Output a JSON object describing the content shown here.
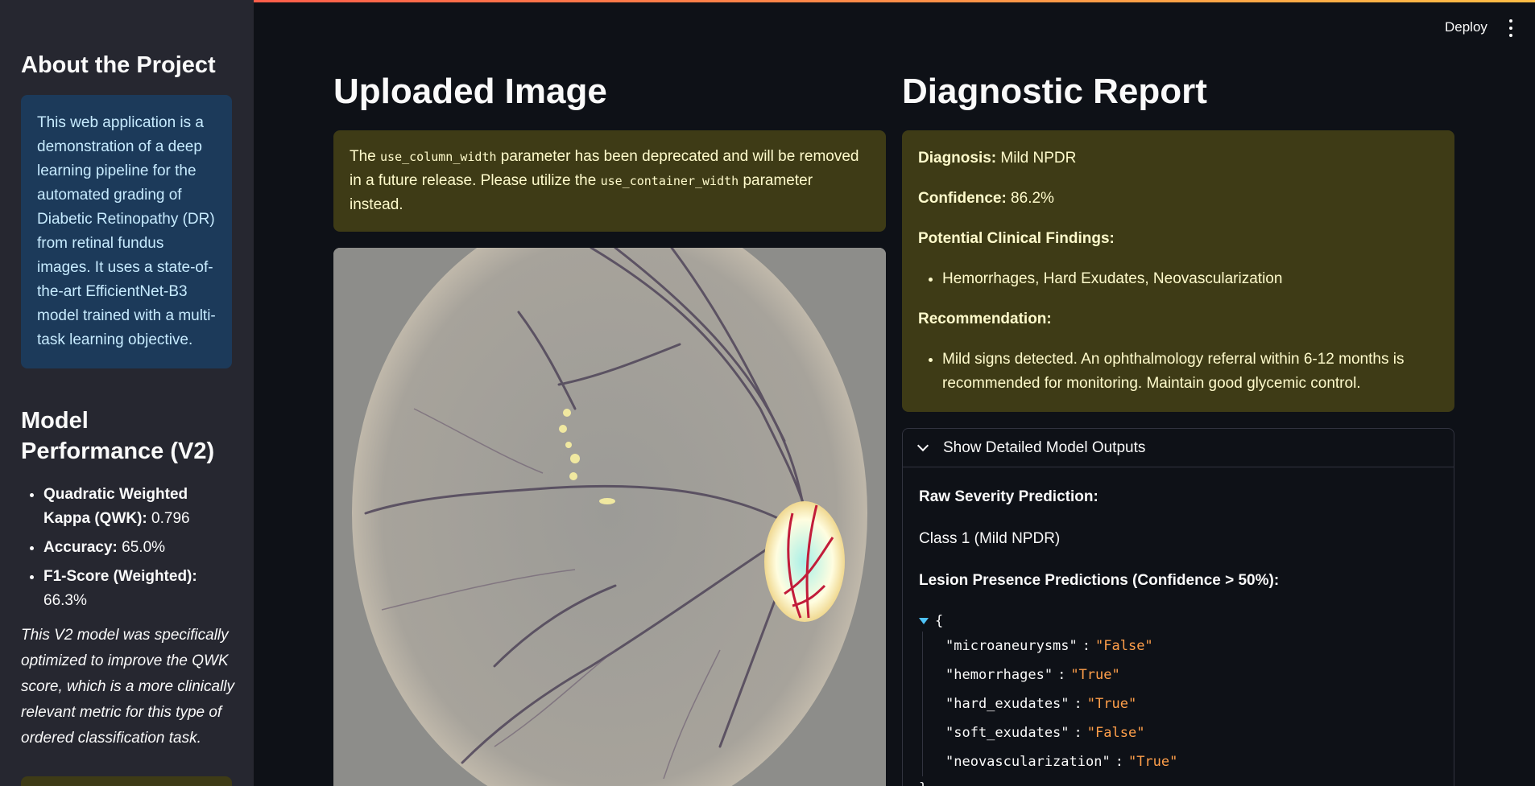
{
  "sidebar": {
    "about_title": "About the Project",
    "about_text": "This web application is a demonstration of a deep learning pipeline for the automated grading of Diabetic Retinopathy (DR) from retinal fundus images. It uses a state-of-the-art EfficientNet-B3 model trained with a multi-task learning objective.",
    "perf_title": "Model Performance (V2)",
    "metrics": [
      {
        "label": "Quadratic Weighted Kappa (QWK):",
        "value": " 0.796"
      },
      {
        "label": "Accuracy:",
        "value": " 65.0%"
      },
      {
        "label": "F1-Score (Weighted):",
        "value": " 66.3%"
      }
    ],
    "note": "This V2 model was specifically optimized to improve the QWK score, which is a more clinically relevant metric for this type of ordered classification task."
  },
  "header": {
    "deploy_label": "Deploy",
    "menu_icon": "kebab-menu-icon"
  },
  "left": {
    "title": "Uploaded Image",
    "warning": {
      "pre": "The ",
      "code1": "use_column_width",
      "mid": " parameter has been deprecated and will be removed in a future release. Please utilize the ",
      "code2": "use_container_width",
      "post": " parameter instead."
    }
  },
  "right": {
    "title": "Diagnostic Report",
    "diagnosis_label": "Diagnosis:",
    "diagnosis_value": " Mild NPDR",
    "confidence_label": "Confidence:",
    "confidence_value": " 86.2%",
    "findings_label": "Potential Clinical Findings:",
    "findings": "Hemorrhages, Hard Exudates, Neovascularization",
    "recommendation_label": "Recommendation:",
    "recommendation": "Mild signs detected. An ophthalmology referral within 6-12 months is recommended for monitoring. Maintain good glycemic control.",
    "expander": {
      "label": "Show Detailed Model Outputs",
      "raw_label": "Raw Severity Prediction:",
      "raw_value": "Class 1 (Mild NPDR)",
      "lesion_label": "Lesion Presence Predictions (Confidence > 50%):",
      "json_open": "{",
      "json_close": "}",
      "lesions": [
        {
          "key": "\"microaneurysms\"",
          "value": "\"False\""
        },
        {
          "key": "\"hemorrhages\"",
          "value": "\"True\""
        },
        {
          "key": "\"hard_exudates\"",
          "value": "\"True\""
        },
        {
          "key": "\"soft_exudates\"",
          "value": "\"False\""
        },
        {
          "key": "\"neovascularization\"",
          "value": "\"True\""
        }
      ]
    }
  },
  "colors": {
    "background": "#0e1117",
    "sidebar": "#262730",
    "info_box": "#1c3a5a",
    "warning_box": "#3e3b16",
    "json_value": "#ff9f4a"
  }
}
